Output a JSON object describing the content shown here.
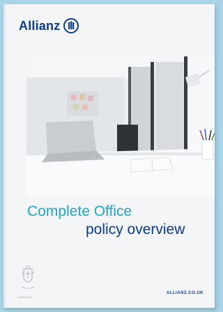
{
  "brand": {
    "name": "Allianz",
    "logo_icon": "allianz-eagle-logo",
    "color": "#0a3c8c"
  },
  "cover": {
    "title_line1": "Complete Office",
    "title_line2": "policy overview",
    "title_line1_color": "#1ea6cc",
    "title_line2_color": "#0a3c8c",
    "photo_subject": "office-desk-laptop-lamp",
    "emblem_icon": "crest-emblem",
    "emblem_caption": "Chartered"
  },
  "footer": {
    "website": "ALLIANZ.CO.UK"
  },
  "background_color": "#a9d3e6"
}
